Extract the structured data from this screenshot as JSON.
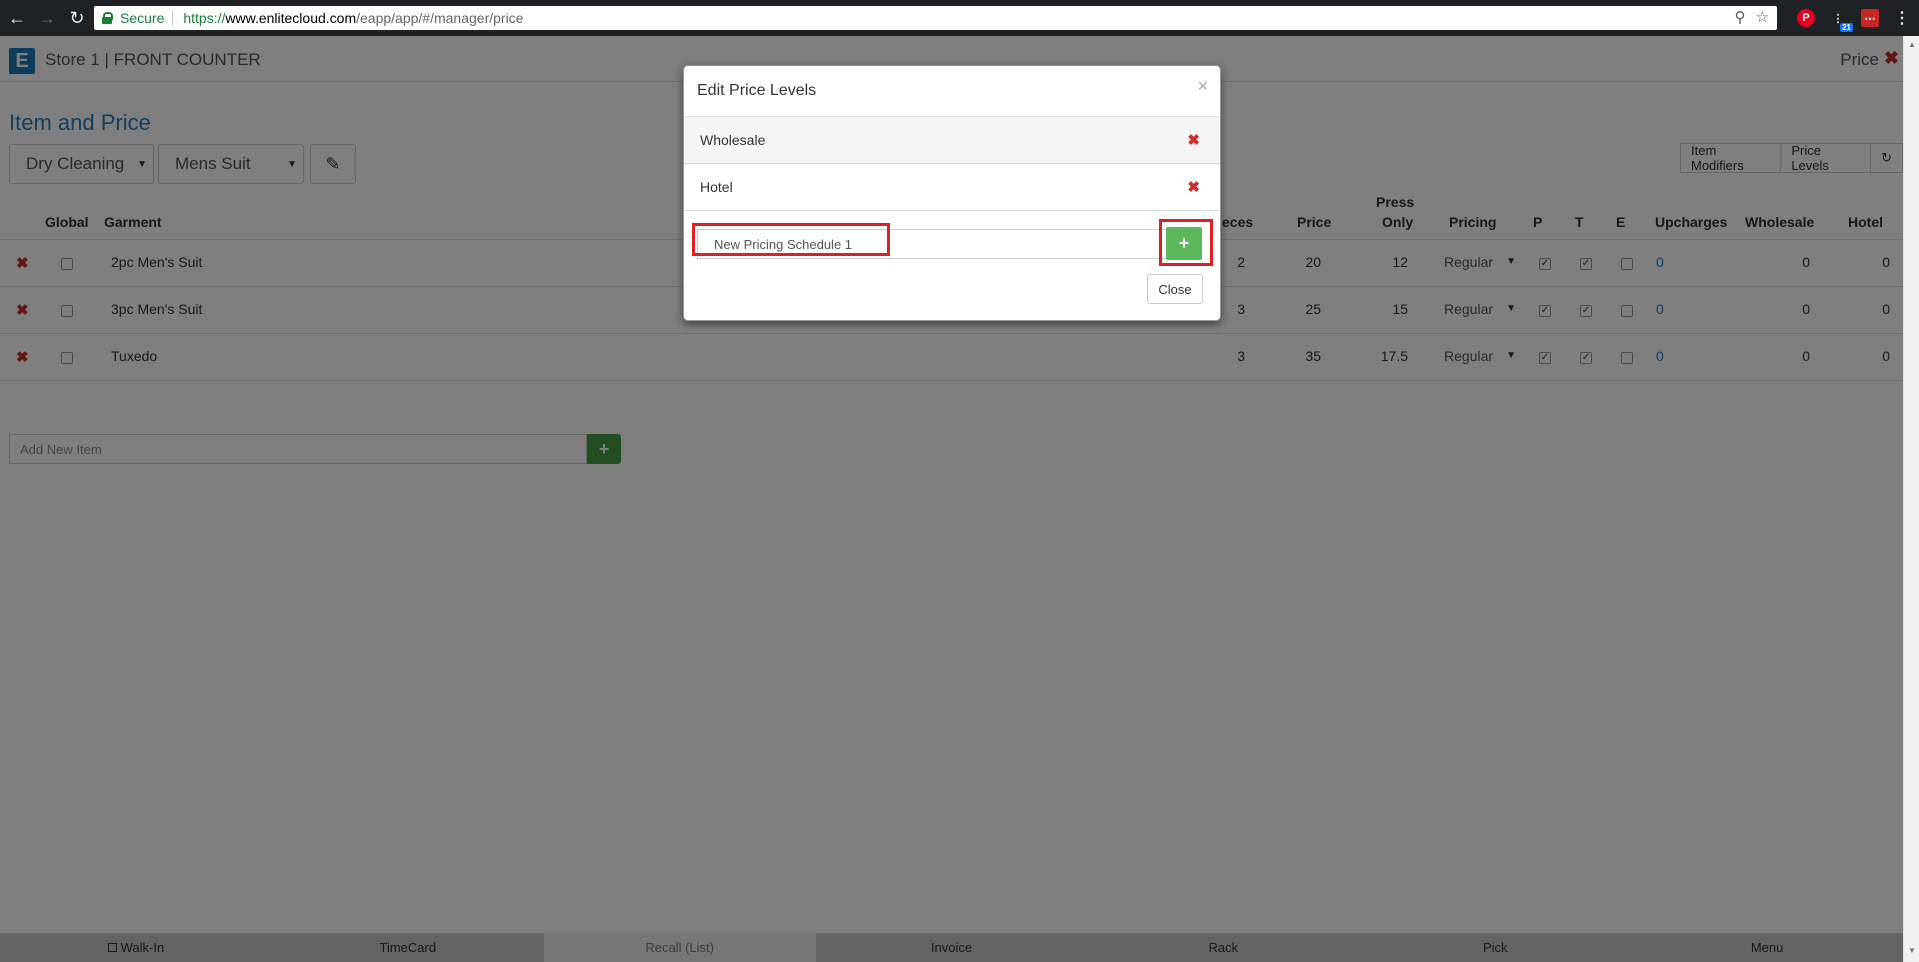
{
  "browser": {
    "secure_label": "Secure",
    "url_scheme": "https://",
    "url_host": "www.enlitecloud.com",
    "url_path": "/eapp/app/#/manager/price",
    "notification_badge": "21"
  },
  "header": {
    "logo_letter": "E",
    "store_title": "Store 1 | FRONT COUNTER",
    "page_label": "Price"
  },
  "main": {
    "title": "Item and Price",
    "category_select": "Dry Cleaning",
    "subcategory_select": "Mens Suit",
    "buttons": {
      "item_modifiers": "Item Modifiers",
      "price_levels": "Price Levels"
    },
    "columns": {
      "global": "Global",
      "garment": "Garment",
      "pieces": "eces",
      "price": "Price",
      "press_only_1": "Press",
      "press_only_2": "Only",
      "pricing": "Pricing",
      "p": "P",
      "t": "T",
      "e": "E",
      "upcharges": "Upcharges",
      "wholesale": "Wholesale",
      "hotel": "Hotel"
    },
    "rows": [
      {
        "garment": "2pc Men's Suit",
        "pieces": "2",
        "price": "20",
        "press_only": "12",
        "pricing": "Regular",
        "p": true,
        "t": true,
        "e": false,
        "upcharges": "0",
        "wholesale": "0",
        "hotel": "0"
      },
      {
        "garment": "3pc Men's Suit",
        "pieces": "3",
        "price": "25",
        "press_only": "15",
        "pricing": "Regular",
        "p": true,
        "t": true,
        "e": false,
        "upcharges": "0",
        "wholesale": "0",
        "hotel": "0"
      },
      {
        "garment": "Tuxedo",
        "pieces": "3",
        "price": "35",
        "press_only": "17.5",
        "pricing": "Regular",
        "p": true,
        "t": true,
        "e": false,
        "upcharges": "0",
        "wholesale": "0",
        "hotel": "0"
      }
    ],
    "add_item_placeholder": "Add New Item"
  },
  "footer": {
    "items": [
      "Walk-In",
      "TimeCard",
      "Recall (List)",
      "Invoice",
      "Rack",
      "Pick",
      "Menu"
    ]
  },
  "modal": {
    "title": "Edit Price Levels",
    "levels": [
      "Wholesale",
      "Hotel"
    ],
    "new_level_value": "New Pricing Schedule 1",
    "close_label": "Close"
  },
  "colors": {
    "accent": "#2a7ab8",
    "danger": "#c9302c",
    "success": "#5cb85c",
    "highlight": "#e02020"
  }
}
